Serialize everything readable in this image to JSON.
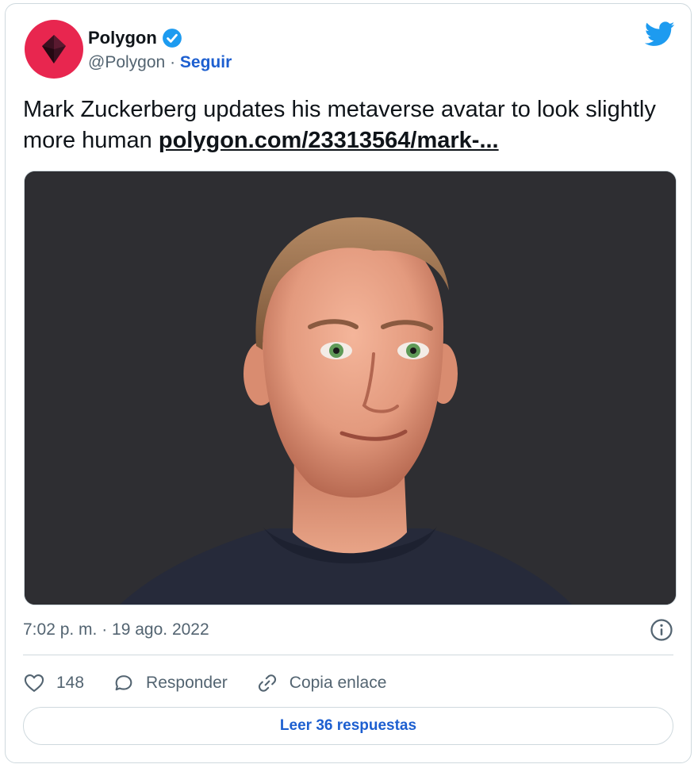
{
  "author": {
    "name": "Polygon",
    "handle": "@Polygon",
    "separator": "·",
    "follow_label": "Seguir",
    "avatar_icon": "polygon-logo-icon",
    "verified_icon": "verified-badge-icon"
  },
  "tweet": {
    "text": "Mark Zuckerberg updates his metaverse avatar to look slightly more human",
    "link_text": "polygon.com/23313564/mark-...",
    "timestamp": "7:02 p. m. · 19 ago. 2022"
  },
  "actions": {
    "like_count": "148",
    "reply_label": "Responder",
    "copy_link_label": "Copia enlace"
  },
  "read_replies_label": "Leer 36 respuestas",
  "colors": {
    "brand_avatar": "#e8264f",
    "link_blue": "#1d5fd0",
    "twitter_blue": "#1d9bf0",
    "text_secondary": "#536471",
    "media_background": "#2e2e32"
  }
}
